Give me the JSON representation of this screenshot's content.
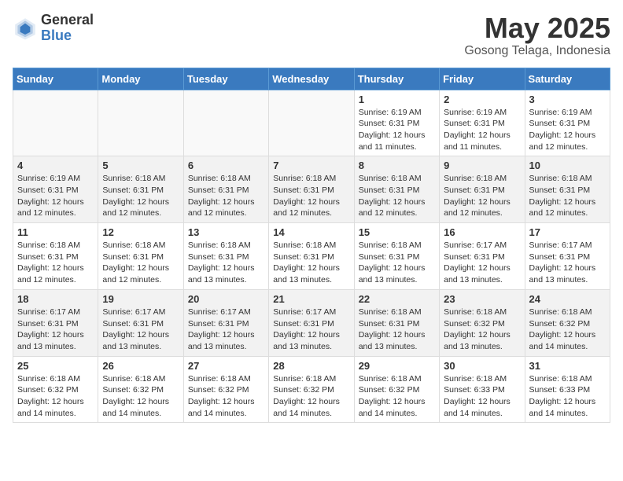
{
  "logo": {
    "general": "General",
    "blue": "Blue"
  },
  "header": {
    "month": "May 2025",
    "location": "Gosong Telaga, Indonesia"
  },
  "weekdays": [
    "Sunday",
    "Monday",
    "Tuesday",
    "Wednesday",
    "Thursday",
    "Friday",
    "Saturday"
  ],
  "weeks": [
    [
      {
        "day": "",
        "info": ""
      },
      {
        "day": "",
        "info": ""
      },
      {
        "day": "",
        "info": ""
      },
      {
        "day": "",
        "info": ""
      },
      {
        "day": "1",
        "info": "Sunrise: 6:19 AM\nSunset: 6:31 PM\nDaylight: 12 hours\nand 11 minutes."
      },
      {
        "day": "2",
        "info": "Sunrise: 6:19 AM\nSunset: 6:31 PM\nDaylight: 12 hours\nand 11 minutes."
      },
      {
        "day": "3",
        "info": "Sunrise: 6:19 AM\nSunset: 6:31 PM\nDaylight: 12 hours\nand 12 minutes."
      }
    ],
    [
      {
        "day": "4",
        "info": "Sunrise: 6:19 AM\nSunset: 6:31 PM\nDaylight: 12 hours\nand 12 minutes."
      },
      {
        "day": "5",
        "info": "Sunrise: 6:18 AM\nSunset: 6:31 PM\nDaylight: 12 hours\nand 12 minutes."
      },
      {
        "day": "6",
        "info": "Sunrise: 6:18 AM\nSunset: 6:31 PM\nDaylight: 12 hours\nand 12 minutes."
      },
      {
        "day": "7",
        "info": "Sunrise: 6:18 AM\nSunset: 6:31 PM\nDaylight: 12 hours\nand 12 minutes."
      },
      {
        "day": "8",
        "info": "Sunrise: 6:18 AM\nSunset: 6:31 PM\nDaylight: 12 hours\nand 12 minutes."
      },
      {
        "day": "9",
        "info": "Sunrise: 6:18 AM\nSunset: 6:31 PM\nDaylight: 12 hours\nand 12 minutes."
      },
      {
        "day": "10",
        "info": "Sunrise: 6:18 AM\nSunset: 6:31 PM\nDaylight: 12 hours\nand 12 minutes."
      }
    ],
    [
      {
        "day": "11",
        "info": "Sunrise: 6:18 AM\nSunset: 6:31 PM\nDaylight: 12 hours\nand 12 minutes."
      },
      {
        "day": "12",
        "info": "Sunrise: 6:18 AM\nSunset: 6:31 PM\nDaylight: 12 hours\nand 12 minutes."
      },
      {
        "day": "13",
        "info": "Sunrise: 6:18 AM\nSunset: 6:31 PM\nDaylight: 12 hours\nand 13 minutes."
      },
      {
        "day": "14",
        "info": "Sunrise: 6:18 AM\nSunset: 6:31 PM\nDaylight: 12 hours\nand 13 minutes."
      },
      {
        "day": "15",
        "info": "Sunrise: 6:18 AM\nSunset: 6:31 PM\nDaylight: 12 hours\nand 13 minutes."
      },
      {
        "day": "16",
        "info": "Sunrise: 6:17 AM\nSunset: 6:31 PM\nDaylight: 12 hours\nand 13 minutes."
      },
      {
        "day": "17",
        "info": "Sunrise: 6:17 AM\nSunset: 6:31 PM\nDaylight: 12 hours\nand 13 minutes."
      }
    ],
    [
      {
        "day": "18",
        "info": "Sunrise: 6:17 AM\nSunset: 6:31 PM\nDaylight: 12 hours\nand 13 minutes."
      },
      {
        "day": "19",
        "info": "Sunrise: 6:17 AM\nSunset: 6:31 PM\nDaylight: 12 hours\nand 13 minutes."
      },
      {
        "day": "20",
        "info": "Sunrise: 6:17 AM\nSunset: 6:31 PM\nDaylight: 12 hours\nand 13 minutes."
      },
      {
        "day": "21",
        "info": "Sunrise: 6:17 AM\nSunset: 6:31 PM\nDaylight: 12 hours\nand 13 minutes."
      },
      {
        "day": "22",
        "info": "Sunrise: 6:18 AM\nSunset: 6:31 PM\nDaylight: 12 hours\nand 13 minutes."
      },
      {
        "day": "23",
        "info": "Sunrise: 6:18 AM\nSunset: 6:32 PM\nDaylight: 12 hours\nand 13 minutes."
      },
      {
        "day": "24",
        "info": "Sunrise: 6:18 AM\nSunset: 6:32 PM\nDaylight: 12 hours\nand 14 minutes."
      }
    ],
    [
      {
        "day": "25",
        "info": "Sunrise: 6:18 AM\nSunset: 6:32 PM\nDaylight: 12 hours\nand 14 minutes."
      },
      {
        "day": "26",
        "info": "Sunrise: 6:18 AM\nSunset: 6:32 PM\nDaylight: 12 hours\nand 14 minutes."
      },
      {
        "day": "27",
        "info": "Sunrise: 6:18 AM\nSunset: 6:32 PM\nDaylight: 12 hours\nand 14 minutes."
      },
      {
        "day": "28",
        "info": "Sunrise: 6:18 AM\nSunset: 6:32 PM\nDaylight: 12 hours\nand 14 minutes."
      },
      {
        "day": "29",
        "info": "Sunrise: 6:18 AM\nSunset: 6:32 PM\nDaylight: 12 hours\nand 14 minutes."
      },
      {
        "day": "30",
        "info": "Sunrise: 6:18 AM\nSunset: 6:33 PM\nDaylight: 12 hours\nand 14 minutes."
      },
      {
        "day": "31",
        "info": "Sunrise: 6:18 AM\nSunset: 6:33 PM\nDaylight: 12 hours\nand 14 minutes."
      }
    ]
  ]
}
